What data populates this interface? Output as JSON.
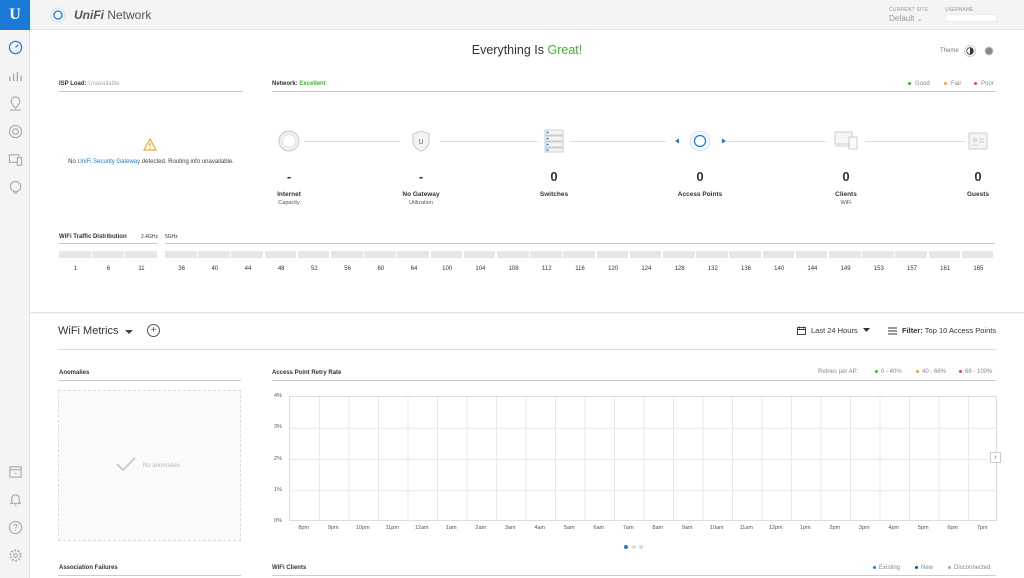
{
  "app": {
    "brand_prefix": "UniFi",
    "brand_suffix": "Network",
    "current_site_caption": "CURRENT SITE",
    "current_site_value": "Default",
    "username_caption": "USERNAME"
  },
  "sidebar": {
    "items": [
      "dashboard-icon",
      "statistics-icon",
      "map-icon",
      "devices-icon",
      "clients-icon",
      "insights-icon"
    ],
    "bottom_items": [
      "events-icon",
      "alerts-icon",
      "help-icon",
      "settings-icon"
    ]
  },
  "status": {
    "headline_prefix": "Everything Is ",
    "headline_status": "Great!",
    "theme_label": "Theme"
  },
  "isp": {
    "label": "ISP Load:",
    "value": "Unavailable",
    "message_pre": "No ",
    "message_link": "UniFi Security Gateway",
    "message_post": " detected. Routing info unavailable."
  },
  "network": {
    "label": "Network:",
    "value": "Excellent",
    "legend": [
      {
        "label": "Good",
        "color": "#38b72d"
      },
      {
        "label": "Fair",
        "color": "#f5a623"
      },
      {
        "label": "Poor",
        "color": "#e74c3c"
      }
    ],
    "nodes": [
      {
        "value": "-",
        "label": "Internet",
        "sub": "Capacity"
      },
      {
        "value": "-",
        "label": "No Gateway",
        "sub": "Utilization"
      },
      {
        "value": "0",
        "label": "Switches",
        "sub": ""
      },
      {
        "value": "0",
        "label": "Access Points",
        "sub": ""
      },
      {
        "value": "0",
        "label": "Clients",
        "sub": "WiFi"
      },
      {
        "value": "0",
        "label": "Guests",
        "sub": ""
      }
    ]
  },
  "wifi_traffic": {
    "label": "WiFi Traffic Distribution",
    "band_24": "2.4GHz",
    "band_5": "5GHz",
    "channels_24": [
      "1",
      "6",
      "11"
    ],
    "channels_5": [
      "36",
      "40",
      "44",
      "48",
      "52",
      "56",
      "60",
      "64",
      "100",
      "104",
      "108",
      "112",
      "116",
      "120",
      "124",
      "128",
      "132",
      "136",
      "140",
      "144",
      "149",
      "153",
      "157",
      "161",
      "165"
    ]
  },
  "metrics": {
    "title": "WiFi Metrics",
    "range": "Last 24 Hours",
    "filter_label": "Filter:",
    "filter_value": "Top 10 Access Points",
    "anomalies_title": "Anomalies",
    "anomalies_empty": "No anomalies",
    "retry_title": "Access Point Retry Rate",
    "retries_caption": "Retries per AP:",
    "retry_legend": [
      {
        "label": "0 - 40%",
        "color": "#38b72d"
      },
      {
        "label": "40 - 66%",
        "color": "#f5a623"
      },
      {
        "label": "66 - 100%",
        "color": "#e74c3c"
      }
    ],
    "y_ticks": [
      "4%",
      "3%",
      "2%",
      "1%",
      "0%"
    ],
    "x_ticks": [
      "8pm",
      "9pm",
      "10pm",
      "11pm",
      "12am",
      "1am",
      "2am",
      "3am",
      "4am",
      "5am",
      "6am",
      "7am",
      "8am",
      "9am",
      "10am",
      "11am",
      "12pm",
      "1pm",
      "2pm",
      "3pm",
      "4pm",
      "5pm",
      "6pm",
      "7pm"
    ],
    "assoc_title": "Association Failures",
    "clients_title": "WiFi Clients",
    "clients_legend": [
      {
        "label": "Existing",
        "color": "#1b7ad8"
      },
      {
        "label": "New",
        "color": "#0b4fa0"
      },
      {
        "label": "Disconnected",
        "color": "#aaaaaa"
      }
    ]
  }
}
